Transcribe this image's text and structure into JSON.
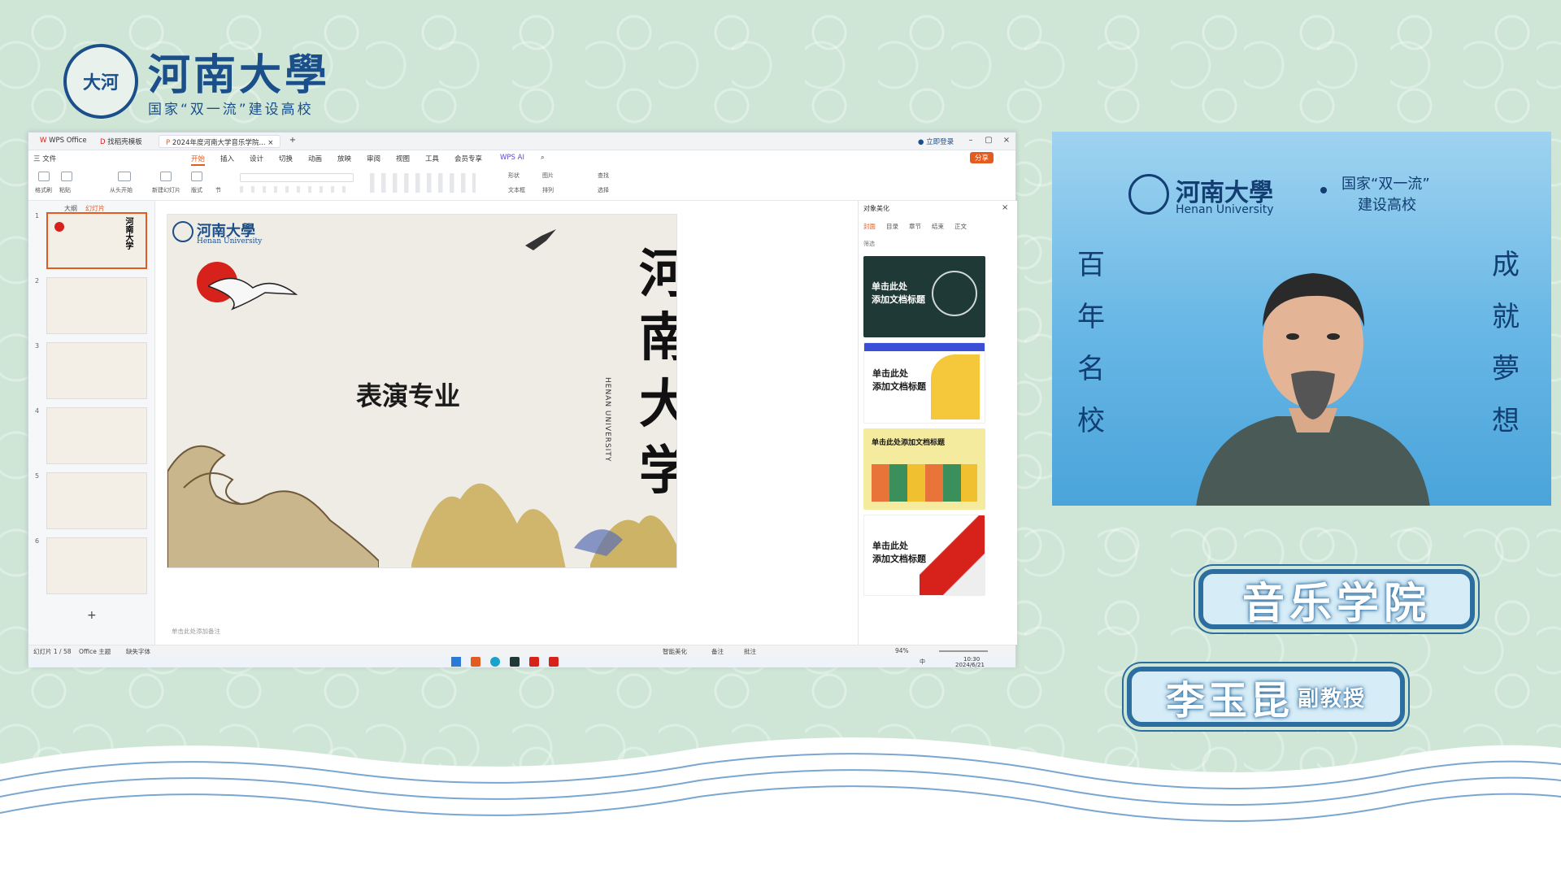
{
  "brand": {
    "title": "河南大學",
    "subtitle": "国家“双一流”建设高校",
    "seal_text": "大河"
  },
  "window": {
    "tabs": [
      "WPS Office",
      "找稻壳模板",
      "2024年度河南大学音乐学院..."
    ],
    "top_right": [
      "立即登录"
    ],
    "share": "分享",
    "menus": [
      "三 文件",
      "开始",
      "插入",
      "设计",
      "切换",
      "动画",
      "放映",
      "审阅",
      "视图",
      "工具",
      "会员专享",
      "WPS AI"
    ],
    "active_menu": "开始",
    "ribbon_labels": [
      "格式刷",
      "粘贴",
      "从头开始",
      "新建幻灯片",
      "版式",
      "节",
      "形状",
      "图片",
      "文本框",
      "排列",
      "查找",
      "选择"
    ],
    "thumb_tabs": [
      "大纲",
      "幻灯片"
    ],
    "thumb_numbers": [
      "1",
      "2",
      "3",
      "4",
      "5",
      "6"
    ],
    "add_slide": "+",
    "slide": {
      "logo_text": "河南大學",
      "logo_sub": "Henan University",
      "perf": "表演专业",
      "big": [
        "河",
        "南",
        "大",
        "学"
      ],
      "vertical": "HENAN UNIVERSITY"
    },
    "notes_placeholder": "单击此处添加备注",
    "panel": {
      "title": "对象美化",
      "tabs": [
        "封面",
        "目录",
        "章节",
        "结束",
        "正文"
      ],
      "filter": "筛选",
      "cards": [
        {
          "text": "单击此处\n添加文档标题",
          "bg": "#1f3a36",
          "fg": "#ffffff"
        },
        {
          "text": "单击此处\n添加文档标题",
          "bg": "#ffffff",
          "fg": "#1a1a1a"
        },
        {
          "text": "单击此处添加文档标题",
          "bg": "#f5eb9e",
          "fg": "#1a1a1a"
        },
        {
          "text": "单击此处\n添加文档标题",
          "bg": "#ffffff",
          "fg": "#1a1a1a"
        }
      ]
    },
    "status": {
      "left": "幻灯片 1 / 58",
      "theme": "Office 主题",
      "font": "缺失字体",
      "beautify": "智能美化",
      "notes": "备注",
      "comment": "批注",
      "zoom": "94%"
    },
    "taskbar": {
      "time": "10:30",
      "date": "2024/6/21",
      "ime": "中"
    }
  },
  "video": {
    "brand": "河南大學",
    "brand_en": "Henan University",
    "slogan": [
      "国家“双一流”",
      "建设高校"
    ],
    "left": [
      "百",
      "年",
      "名",
      "校"
    ],
    "right": [
      "成",
      "就",
      "夢",
      "想"
    ]
  },
  "banners": {
    "college": "音乐学院",
    "name": "李玉昆",
    "title": "副教授"
  },
  "colors": {
    "accent": "#e25c22",
    "brand_blue": "#1b4f8a",
    "bg": "#cfe6d7"
  }
}
